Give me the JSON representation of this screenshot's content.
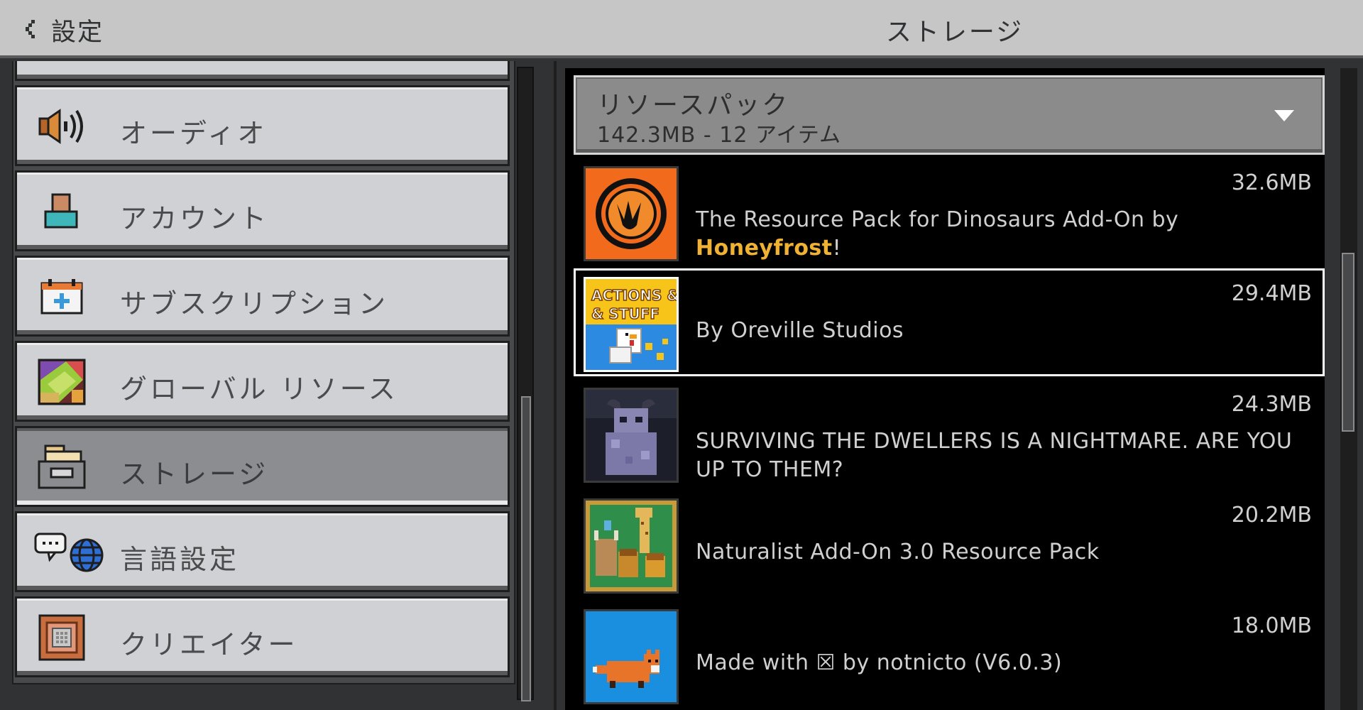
{
  "header": {
    "back_label": "設定",
    "title": "ストレージ"
  },
  "sidebar": {
    "items": [
      {
        "label": "オーディオ",
        "icon": "speaker-icon",
        "selected": false
      },
      {
        "label": "アカウント",
        "icon": "account-icon",
        "selected": false
      },
      {
        "label": "サブスクリプション",
        "icon": "subscription-icon",
        "selected": false
      },
      {
        "label": "グローバル リソース",
        "icon": "global-resources-icon",
        "selected": false
      },
      {
        "label": "ストレージ",
        "icon": "storage-icon",
        "selected": true
      },
      {
        "label": "言語設定",
        "icon": "language-icon",
        "selected": false
      },
      {
        "label": "クリエイター",
        "icon": "creator-icon",
        "selected": false
      }
    ]
  },
  "storage": {
    "dropdown": {
      "title": "リソースパック",
      "summary": "142.3MB - 12 アイテム"
    },
    "packs": [
      {
        "size": "32.6MB",
        "desc_prefix": "The Resource Pack for Dinosaurs Add-On by ",
        "desc_highlight": "Honeyfrost",
        "desc_suffix": "!",
        "icon": "dinosaur-pack-icon",
        "selected": false
      },
      {
        "size": "29.4MB",
        "desc": "By Oreville Studios",
        "icon": "actions-and-stuff-pack-icon",
        "thumb_text": "ACTIONS & STUFF",
        "selected": true
      },
      {
        "size": "24.3MB",
        "desc": "SURVIVING THE DWELLERS IS A NIGHTMARE. ARE YOU UP TO THEM?",
        "icon": "dwellers-pack-icon",
        "selected": false
      },
      {
        "size": "20.2MB",
        "desc": "Naturalist Add-On 3.0 Resource Pack",
        "icon": "naturalist-pack-icon",
        "selected": false
      },
      {
        "size": "18.0MB",
        "desc": "Made with ☒ by notnicto (V6.0.3)",
        "icon": "fox-pack-icon",
        "selected": false
      }
    ]
  },
  "colors": {
    "highlight": "#f0b232",
    "header_bg": "#c6c6c6",
    "selected_item_bg": "#8c8d90"
  }
}
